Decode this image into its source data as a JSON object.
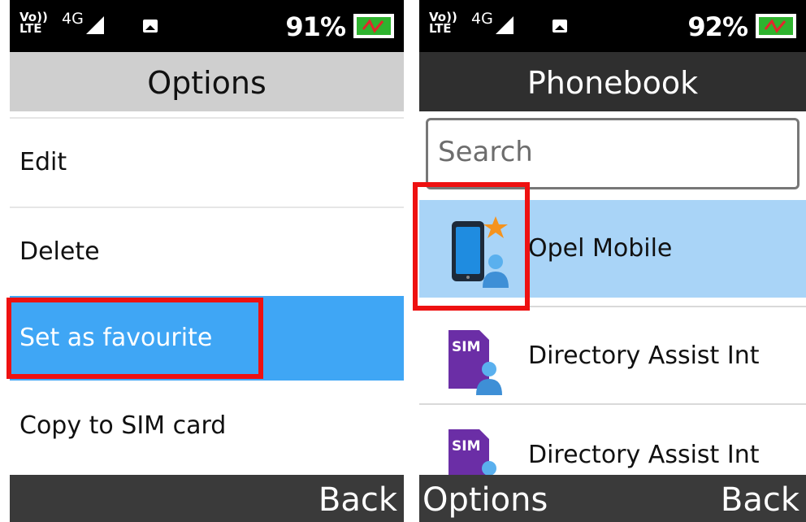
{
  "left_screen": {
    "status": {
      "volte_top": "Vo))",
      "volte_bottom": "LTE",
      "network": "4G",
      "signal_badge": "4G",
      "battery_pct": "91%"
    },
    "title": "Options",
    "menu": [
      {
        "label": "Edit"
      },
      {
        "label": "Delete"
      },
      {
        "label": "Set as favourite"
      },
      {
        "label": "Copy to SIM card"
      }
    ],
    "softkeys": {
      "left": "",
      "right": "Back"
    }
  },
  "right_screen": {
    "status": {
      "volte_top": "Vo))",
      "volte_bottom": "LTE",
      "network": "4G",
      "signal_badge": "4G",
      "battery_pct": "92%"
    },
    "title": "Phonebook",
    "search": {
      "placeholder": "Search",
      "value": ""
    },
    "contacts": [
      {
        "name": "Opel Mobile",
        "icon": "phone-contact-favourite-icon"
      },
      {
        "name": "Directory Assist Int",
        "icon": "sim-contact-icon",
        "sim_label": "SIM"
      },
      {
        "name": "Directory Assist Int",
        "icon": "sim-contact-icon",
        "sim_label": "SIM"
      }
    ],
    "softkeys": {
      "left": "Options",
      "right": "Back"
    }
  },
  "colors": {
    "selection_blue": "#3fa6f5",
    "contact_selected": "#a9d4f7",
    "annotation_red": "#ee1111",
    "battery_green": "#2fb32f",
    "favourite_star": "#f5931e"
  }
}
